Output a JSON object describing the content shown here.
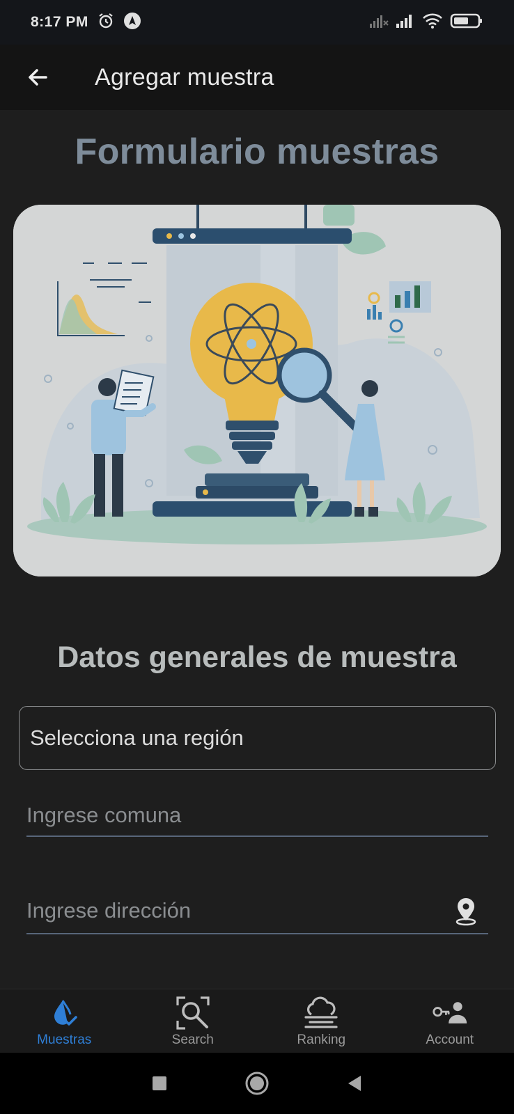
{
  "status_bar": {
    "time": "8:17 PM",
    "icons": [
      "alarm-icon",
      "navigation-icon",
      "signal-off-icon",
      "signal-icon",
      "wifi-icon",
      "battery-icon"
    ]
  },
  "app_bar": {
    "title": "Agregar muestra",
    "back_icon": "arrow-left-icon"
  },
  "page": {
    "title": "Formulario muestras",
    "section_title": "Datos generales de muestra"
  },
  "form": {
    "region_select": {
      "value": "Selecciona una región"
    },
    "comuna_input": {
      "placeholder": "Ingrese comuna"
    },
    "direccion_input": {
      "placeholder": "Ingrese dirección",
      "icon": "location-pin-icon"
    }
  },
  "bottom_nav": {
    "items": [
      {
        "label": "Muestras",
        "icon": "water-drop-check-icon",
        "active": true
      },
      {
        "label": "Search",
        "icon": "search-icon",
        "active": false
      },
      {
        "label": "Ranking",
        "icon": "cloud-ranking-icon",
        "active": false
      },
      {
        "label": "Account",
        "icon": "account-key-icon",
        "active": false
      }
    ]
  },
  "colors": {
    "accent": "#2f7fd6",
    "form_title": "#7e8c9a",
    "background": "#1e1e1e"
  }
}
